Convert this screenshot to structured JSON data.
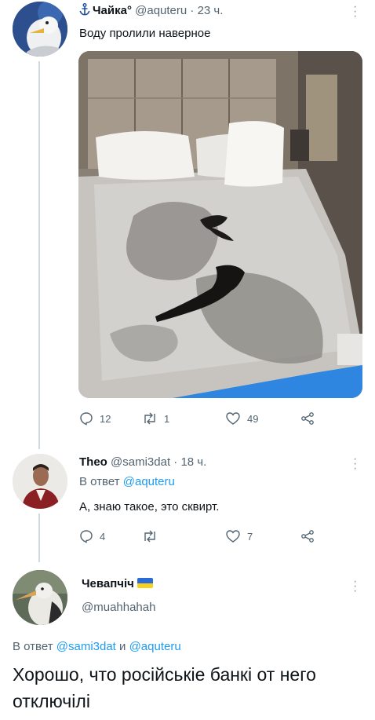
{
  "tweet1": {
    "anchor_icon": "anchor-icon",
    "name": "Чайка°",
    "handle": "@aquteru",
    "dot": "·",
    "time": "23 ч.",
    "text": "Воду пролили наверное",
    "photo_icon": "bed-photo",
    "replies": "12",
    "retweets": "1",
    "likes": "49"
  },
  "tweet2": {
    "name": "Theo",
    "handle": "@sami3dat",
    "dot": "·",
    "time": "18 ч.",
    "reply_prefix": "В ответ",
    "reply_to": "@aquteru",
    "text": "А, знаю такое, это сквирт.",
    "replies": "4",
    "retweets": "",
    "likes": "7"
  },
  "tweet3": {
    "name": "Чевапчіч",
    "flag_icon": "ukraine-flag-icon",
    "handle": "@muahhahah",
    "reply_prefix": "В ответ",
    "reply_to_1": "@sami3dat",
    "reply_and": "и",
    "reply_to_2": "@aquteru",
    "text": "Хорошо, что російськіе банкі от него отключілі"
  },
  "colors": {
    "accent": "#1d9bf0",
    "muted": "#536471",
    "flag_blue": "#2a6bd6",
    "flag_yellow": "#f7d21c"
  }
}
